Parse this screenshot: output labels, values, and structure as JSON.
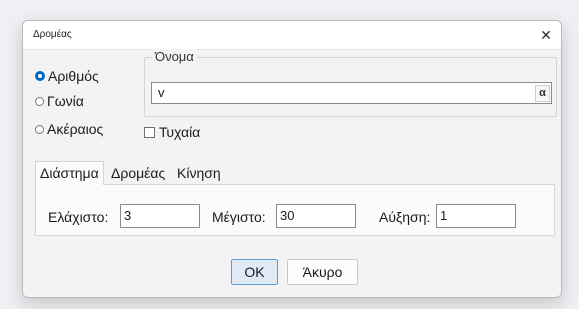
{
  "window": {
    "title": "Δρομέας",
    "close_glyph": "✕"
  },
  "type_options": [
    {
      "label": "Αριθμός",
      "checked": true
    },
    {
      "label": "Γωνία",
      "checked": false
    },
    {
      "label": "Ακέραιος",
      "checked": false
    }
  ],
  "name_group": {
    "legend": "Όνομα",
    "value": "v",
    "alpha_button": "α"
  },
  "random_checkbox": {
    "label": "Τυχαία",
    "checked": false
  },
  "tabs": [
    {
      "label": "Διάστημα",
      "active": true
    },
    {
      "label": "Δρομέας",
      "active": false
    },
    {
      "label": "Κίνηση",
      "active": false
    }
  ],
  "interval": {
    "min_label": "Ελάχιστο:",
    "min_value": "3",
    "max_label": "Μέγιστο:",
    "max_value": "30",
    "step_label": "Αύξηση:",
    "step_value": "1"
  },
  "buttons": {
    "ok": "OK",
    "cancel": "Άκυρο"
  },
  "colors": {
    "accent": "#0067c0",
    "ok_border": "#5c9ad6",
    "ok_bg": "#dfeaf6"
  }
}
